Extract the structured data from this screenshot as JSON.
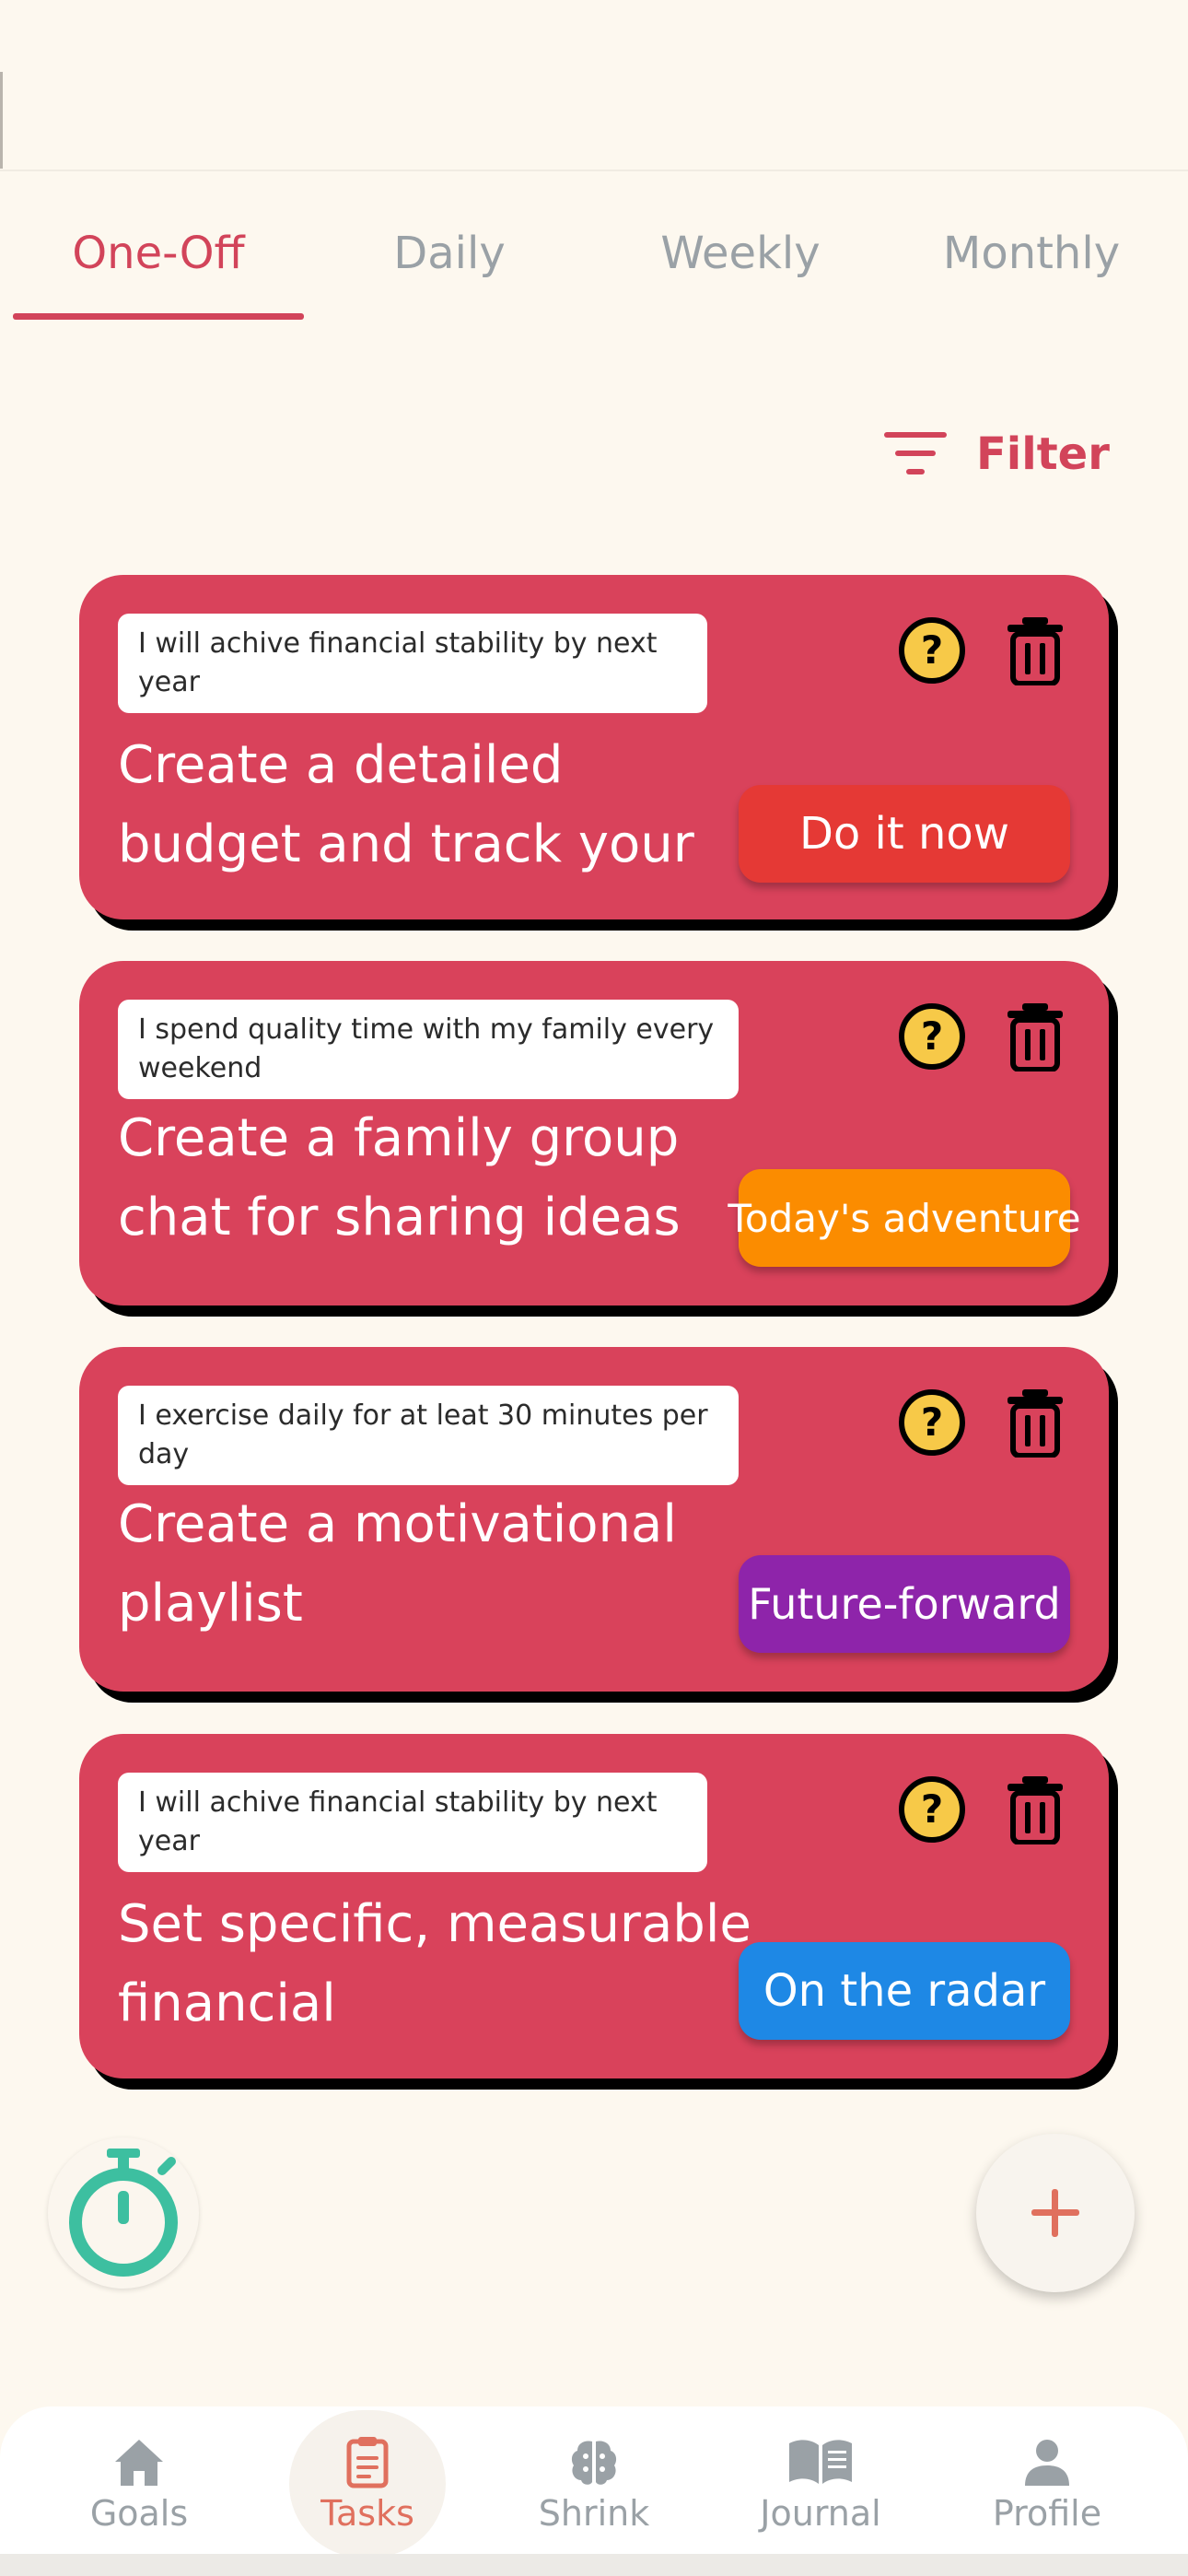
{
  "tabs": [
    {
      "label": "One-Off",
      "active": true
    },
    {
      "label": "Daily",
      "active": false
    },
    {
      "label": "Weekly",
      "active": false
    },
    {
      "label": "Monthly",
      "active": false
    }
  ],
  "filter": {
    "label": "Filter"
  },
  "tasks": [
    {
      "goal": "I will achive financial stability by next year",
      "title": "Create a detailed budget and track your",
      "badge": "Do it now",
      "badge_color": "#e53935"
    },
    {
      "goal": "I spend quality time with my family every weekend",
      "title": "Create a family group chat for sharing ideas",
      "badge": "Today's adventure",
      "badge_color": "#fb8c00"
    },
    {
      "goal": "I exercise daily for at leat 30 minutes per day",
      "title": "Create a motivational playlist",
      "badge": "Future-forward",
      "badge_color": "#8e24aa"
    },
    {
      "goal": "I will achive financial stability by next year",
      "title": "Set specific, measurable financial",
      "badge": "On the radar",
      "badge_color": "#1e88e5"
    }
  ],
  "nav": [
    {
      "label": "Goals",
      "icon": "home-icon",
      "active": false
    },
    {
      "label": "Tasks",
      "icon": "clipboard-icon",
      "active": true
    },
    {
      "label": "Shrink",
      "icon": "brain-icon",
      "active": false
    },
    {
      "label": "Journal",
      "icon": "book-icon",
      "active": false
    },
    {
      "label": "Profile",
      "icon": "person-icon",
      "active": false
    }
  ],
  "colors": {
    "accent": "#d2445a",
    "card": "#d9425b",
    "timer": "#3dbfa0",
    "background": "#fdf8ef"
  }
}
